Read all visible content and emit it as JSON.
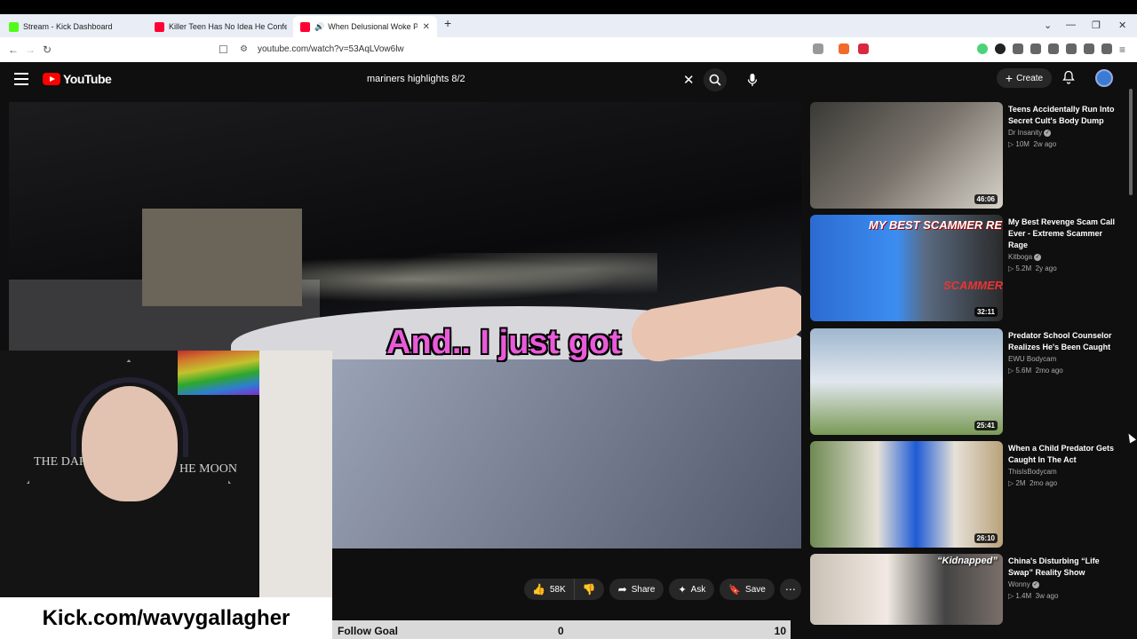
{
  "browser": {
    "tabs": [
      {
        "title": "Stream - Kick Dashboard",
        "favicon_color": "#53fc18"
      },
      {
        "title": "Killer Teen Has No Idea He Confesse",
        "favicon_color": "#ff0033"
      },
      {
        "title": "When Delusional Woke Peopl",
        "favicon_color": "#ff0033"
      }
    ],
    "url": "youtube.com/watch?v=53AqLVow6lw"
  },
  "youtube": {
    "logo_text": "YouTube",
    "search_query": "mariners highlights 8/2",
    "create_label": "Create"
  },
  "video": {
    "caption": "And.. I just got",
    "actions": {
      "likes": "58K",
      "share": "Share",
      "ask": "Ask",
      "save": "Save"
    }
  },
  "overlay": {
    "shirt_text_left": "THE DARK",
    "shirt_text_right": "HE MOON",
    "kick_url": "Kick.com/wavygallagher",
    "goal": {
      "label": "Follow Goal",
      "current": 0,
      "target": 10
    }
  },
  "recommendations": [
    {
      "title": "Teens Accidentally Run Into Secret Cult's Body Dump",
      "channel": "Dr Insanity",
      "verified": true,
      "views": "10M",
      "age": "2w ago",
      "duration": "46:06"
    },
    {
      "title": "My Best Revenge Scam Call Ever - Extreme Scammer Rage",
      "channel": "Kitboga",
      "verified": true,
      "views": "5.2M",
      "age": "2y ago",
      "duration": "32:11",
      "thumb_text": "MY BEST SCAMMER REVENGE",
      "thumb_text2": "SCAMMER"
    },
    {
      "title": "Predator School Counselor Realizes He's Been Caught",
      "channel": "EWU Bodycam",
      "verified": false,
      "views": "5.6M",
      "age": "2mo ago",
      "duration": "25:41"
    },
    {
      "title": "When a Child Predator Gets Caught In The Act",
      "channel": "ThisIsBodycam",
      "verified": false,
      "views": "2M",
      "age": "2mo ago",
      "duration": "26:10"
    },
    {
      "title": "China's Disturbing “Life Swap” Reality Show",
      "channel": "Wonny",
      "verified": true,
      "views": "1.4M",
      "age": "3w ago",
      "duration": "",
      "thumb_text": "“Kidnapped”"
    }
  ]
}
